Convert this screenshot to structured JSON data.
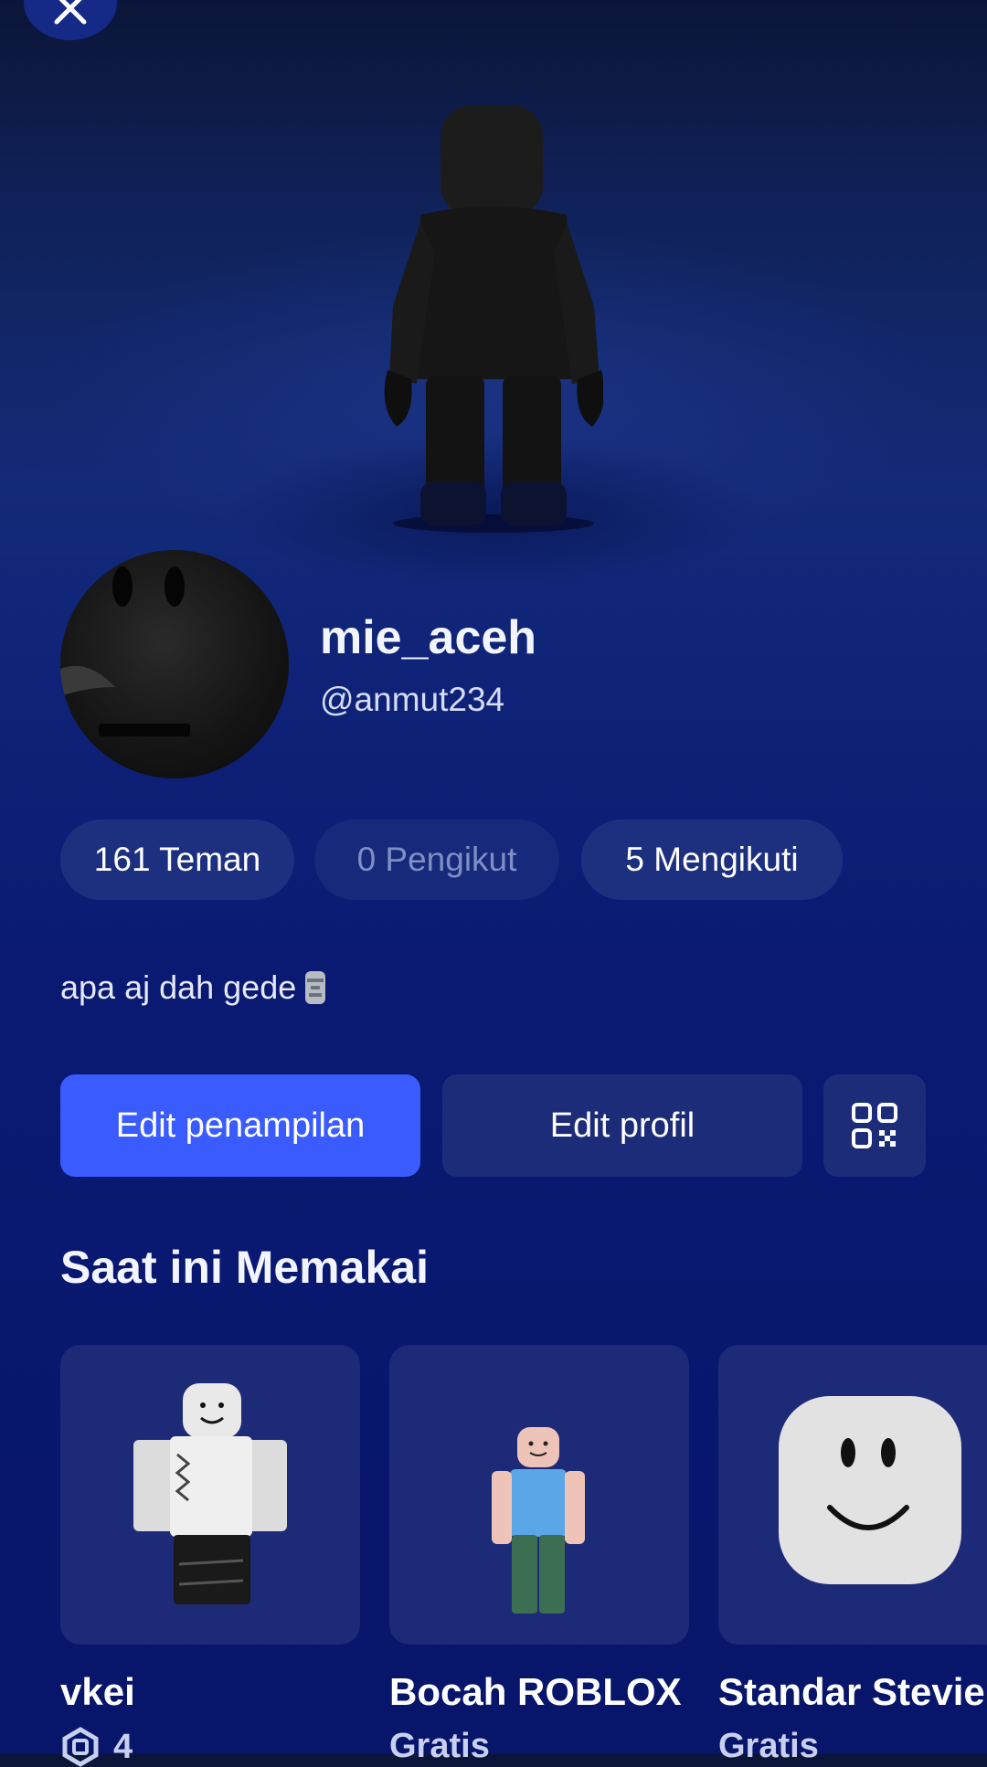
{
  "profile": {
    "display_name": "mie_aceh",
    "username": "@anmut234",
    "bio": "apa aj dah gede"
  },
  "stats": {
    "friends": "161 Teman",
    "followers": "0 Pengikut",
    "following": "5 Mengikuti"
  },
  "actions": {
    "edit_appearance": "Edit penampilan",
    "edit_profile": "Edit profil"
  },
  "currently_wearing": {
    "title": "Saat ini Memakai",
    "items": [
      {
        "name": "vkei",
        "price": "4"
      },
      {
        "name": "Bocah ROBLOX",
        "price": "Gratis"
      },
      {
        "name": "Standar Stevie",
        "price": "Gratis"
      }
    ]
  },
  "icons": [
    "close-icon",
    "qr-code-icon",
    "moai-emoji-icon",
    "robux-icon"
  ],
  "colors": {
    "primary_button": "#3a5cff",
    "secondary_button": "#1d2c78",
    "background": "#0a1a73"
  }
}
